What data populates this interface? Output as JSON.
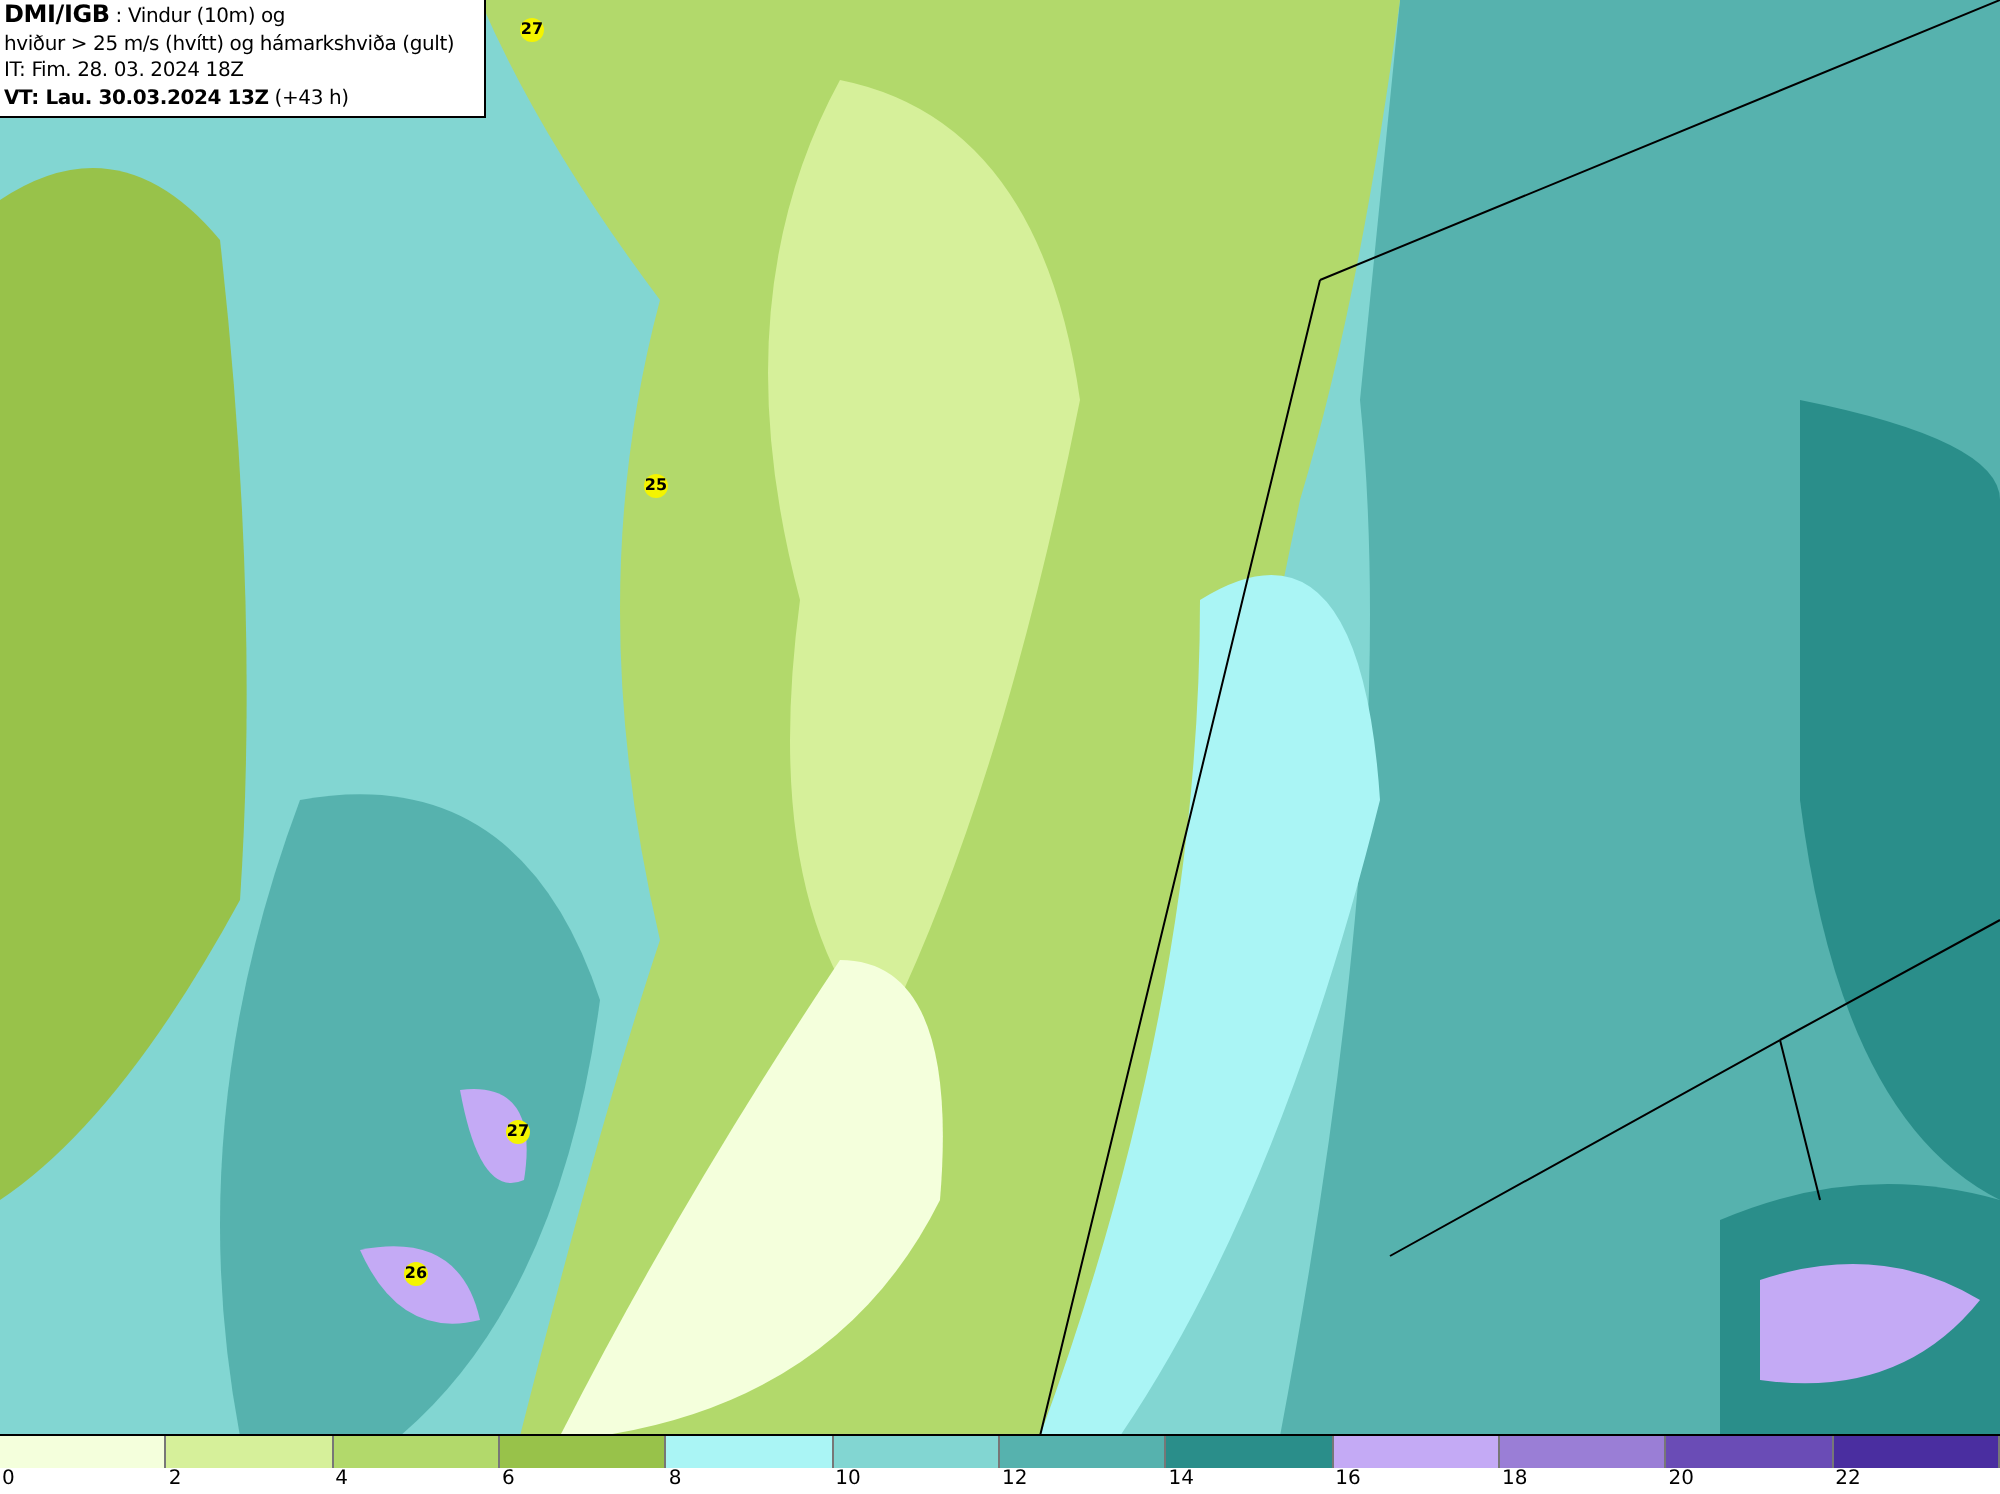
{
  "info_box": {
    "source": "DMI/IGB",
    "line_1": " : Vindur (10m) og",
    "line_2": "hviður > 25 m/s (hvítt) og hámarkshviða (gult)",
    "line_3": "IT: Fim. 28. 03. 2024 18Z",
    "valid_time": "VT: Lau. 30.03.2024 13Z",
    "valid_offset": " (+43 h)"
  },
  "gust_markers": [
    {
      "label": "27"
    },
    {
      "label": "25"
    },
    {
      "label": "27"
    },
    {
      "label": "26"
    }
  ],
  "legend": [
    {
      "label": "0",
      "color": "#f4ffdc"
    },
    {
      "label": "2",
      "color": "#d6f09a"
    },
    {
      "label": "4",
      "color": "#b2d96b"
    },
    {
      "label": "6",
      "color": "#98c24a"
    },
    {
      "label": "8",
      "color": "#aaf5f5"
    },
    {
      "label": "10",
      "color": "#82d6d2"
    },
    {
      "label": "12",
      "color": "#56b2ae"
    },
    {
      "label": "14",
      "color": "#2a8e8a"
    },
    {
      "label": "16",
      "color": "#c4aaf5"
    },
    {
      "label": "18",
      "color": "#9a7ed6"
    },
    {
      "label": "20",
      "color": "#6a4cb6"
    },
    {
      "label": "22",
      "color": "#4a2ea0"
    }
  ]
}
